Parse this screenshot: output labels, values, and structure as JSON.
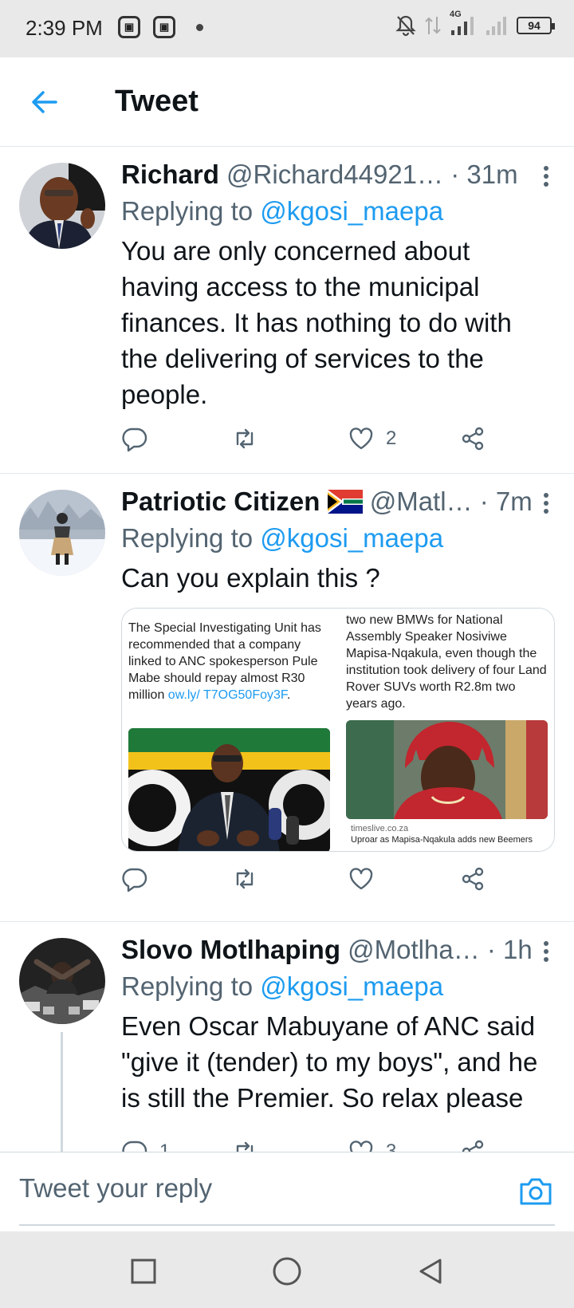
{
  "status_bar": {
    "time": "2:39 PM",
    "network": "4G",
    "battery": "94",
    "notification_icons": [
      "app-notification-icon",
      "app-notification-icon"
    ]
  },
  "header": {
    "title": "Tweet",
    "back_icon": "back-arrow-icon"
  },
  "accent_color": "#1d9bf0",
  "tweets": [
    {
      "name": "Richard",
      "handle": "@Richard44921…",
      "time": "· 31m",
      "replying_prefix": "Replying to ",
      "replying_to": "@kgosi_maepa",
      "text": "You are only concerned about having access to the municipal finances.  It has nothing to do with the delivering of services to the people.",
      "likes": "2",
      "replies": "",
      "retweets": ""
    },
    {
      "name": "Patriotic Citizen",
      "flag": "South Africa flag",
      "handle": "@Matl…",
      "time": "· 7m",
      "replying_prefix": "Replying to ",
      "replying_to": "@kgosi_maepa",
      "text": "Can you explain this ?",
      "media": [
        {
          "text": "The Special Investigating Unit has recommended that a company linked to ANC spokesperson Pule Mabe should repay almost R30 million ",
          "link": "ow.ly/ T7OG50Foy3F",
          "text_end": "."
        },
        {
          "text": "two new BMWs for National Assembly Speaker Nosiviwe Mapisa-Nqakula, even though the institution took delivery of four Land Rover SUVs worth R2.8m two years ago.",
          "site": "timeslive.co.za",
          "headline": "Uproar as Mapisa-Nqakula adds new Beemers"
        }
      ]
    },
    {
      "name": "Slovo Motlhaping",
      "handle": "@Motlha…",
      "time": "· 1h",
      "replying_prefix": "Replying to ",
      "replying_to": "@kgosi_maepa",
      "text": "Even Oscar Mabuyane of ANC said \"give it (tender) to my boys\", and he is still the Premier. So relax please",
      "replies": "1",
      "likes": "3"
    }
  ],
  "composer": {
    "placeholder": "Tweet your reply",
    "camera_icon": "camera-icon"
  },
  "nav_bar": {
    "buttons": [
      "recents-square-icon",
      "home-circle-icon",
      "back-triangle-icon"
    ]
  }
}
